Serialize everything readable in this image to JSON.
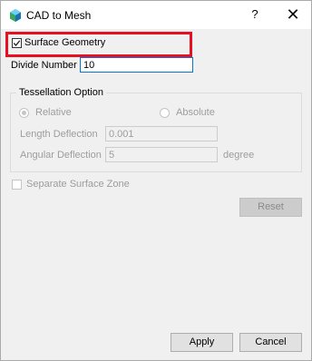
{
  "window": {
    "title": "CAD to Mesh",
    "help": "?",
    "close": "✕"
  },
  "surface_geometry": {
    "label": "Surface Geometry",
    "checked": true
  },
  "divide_number": {
    "label": "Divide Number",
    "value": "10"
  },
  "tessellation": {
    "title": "Tessellation Option",
    "relative_label": "Relative",
    "absolute_label": "Absolute",
    "selected": "Relative",
    "length_label": "Length Deflection",
    "length_value": "0.001",
    "angular_label": "Angular Deflection",
    "angular_value": "5",
    "angular_unit": "degree"
  },
  "separate_surface_zone": {
    "label": "Separate Surface Zone",
    "checked": false
  },
  "buttons": {
    "reset": "Reset",
    "apply": "Apply",
    "cancel": "Cancel"
  },
  "colors": {
    "highlight": "#e81020",
    "focus_border": "#0078d7"
  }
}
